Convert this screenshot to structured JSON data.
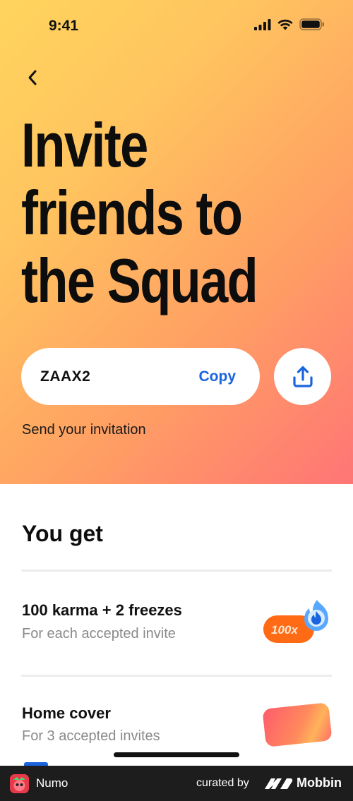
{
  "status_bar": {
    "time": "9:41"
  },
  "header": {
    "title_lines": [
      "Invite",
      "friends to",
      "the Squad"
    ]
  },
  "invite": {
    "code": "ZAAX2",
    "copy_label": "Copy",
    "send_text": "Send your invitation"
  },
  "rewards": {
    "section_title": "You get",
    "items": [
      {
        "title": "100 karma + 2 freezes",
        "subtitle": "For each accepted invite",
        "badge_text": "100x"
      },
      {
        "title": "Home cover",
        "subtitle": "For 3 accepted invites"
      }
    ]
  },
  "footer": {
    "app_name": "Numo",
    "curated_by": "curated by",
    "brand": "Mobbin"
  },
  "colors": {
    "gradient_start": "#ffd45e",
    "gradient_end": "#ff7576",
    "accent_blue": "#1a64e0",
    "badge_orange": "#ff6a14"
  },
  "icons": [
    "back-chevron-icon",
    "share-upload-icon",
    "signal-icon",
    "wifi-icon",
    "battery-icon",
    "flame-icon"
  ]
}
